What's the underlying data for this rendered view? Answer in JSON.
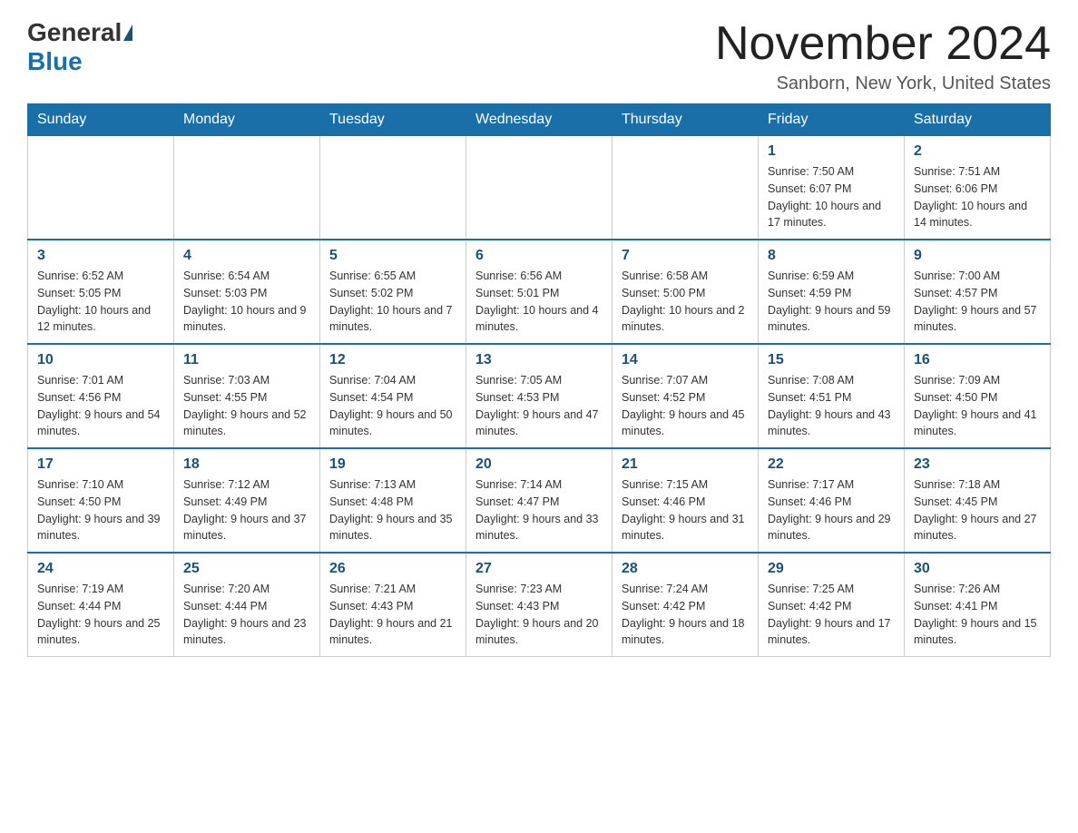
{
  "header": {
    "logo_general": "General",
    "logo_blue": "Blue",
    "month_title": "November 2024",
    "location": "Sanborn, New York, United States"
  },
  "weekdays": [
    "Sunday",
    "Monday",
    "Tuesday",
    "Wednesday",
    "Thursday",
    "Friday",
    "Saturday"
  ],
  "weeks": [
    [
      {
        "day": "",
        "sunrise": "",
        "sunset": "",
        "daylight": ""
      },
      {
        "day": "",
        "sunrise": "",
        "sunset": "",
        "daylight": ""
      },
      {
        "day": "",
        "sunrise": "",
        "sunset": "",
        "daylight": ""
      },
      {
        "day": "",
        "sunrise": "",
        "sunset": "",
        "daylight": ""
      },
      {
        "day": "",
        "sunrise": "",
        "sunset": "",
        "daylight": ""
      },
      {
        "day": "1",
        "sunrise": "Sunrise: 7:50 AM",
        "sunset": "Sunset: 6:07 PM",
        "daylight": "Daylight: 10 hours and 17 minutes."
      },
      {
        "day": "2",
        "sunrise": "Sunrise: 7:51 AM",
        "sunset": "Sunset: 6:06 PM",
        "daylight": "Daylight: 10 hours and 14 minutes."
      }
    ],
    [
      {
        "day": "3",
        "sunrise": "Sunrise: 6:52 AM",
        "sunset": "Sunset: 5:05 PM",
        "daylight": "Daylight: 10 hours and 12 minutes."
      },
      {
        "day": "4",
        "sunrise": "Sunrise: 6:54 AM",
        "sunset": "Sunset: 5:03 PM",
        "daylight": "Daylight: 10 hours and 9 minutes."
      },
      {
        "day": "5",
        "sunrise": "Sunrise: 6:55 AM",
        "sunset": "Sunset: 5:02 PM",
        "daylight": "Daylight: 10 hours and 7 minutes."
      },
      {
        "day": "6",
        "sunrise": "Sunrise: 6:56 AM",
        "sunset": "Sunset: 5:01 PM",
        "daylight": "Daylight: 10 hours and 4 minutes."
      },
      {
        "day": "7",
        "sunrise": "Sunrise: 6:58 AM",
        "sunset": "Sunset: 5:00 PM",
        "daylight": "Daylight: 10 hours and 2 minutes."
      },
      {
        "day": "8",
        "sunrise": "Sunrise: 6:59 AM",
        "sunset": "Sunset: 4:59 PM",
        "daylight": "Daylight: 9 hours and 59 minutes."
      },
      {
        "day": "9",
        "sunrise": "Sunrise: 7:00 AM",
        "sunset": "Sunset: 4:57 PM",
        "daylight": "Daylight: 9 hours and 57 minutes."
      }
    ],
    [
      {
        "day": "10",
        "sunrise": "Sunrise: 7:01 AM",
        "sunset": "Sunset: 4:56 PM",
        "daylight": "Daylight: 9 hours and 54 minutes."
      },
      {
        "day": "11",
        "sunrise": "Sunrise: 7:03 AM",
        "sunset": "Sunset: 4:55 PM",
        "daylight": "Daylight: 9 hours and 52 minutes."
      },
      {
        "day": "12",
        "sunrise": "Sunrise: 7:04 AM",
        "sunset": "Sunset: 4:54 PM",
        "daylight": "Daylight: 9 hours and 50 minutes."
      },
      {
        "day": "13",
        "sunrise": "Sunrise: 7:05 AM",
        "sunset": "Sunset: 4:53 PM",
        "daylight": "Daylight: 9 hours and 47 minutes."
      },
      {
        "day": "14",
        "sunrise": "Sunrise: 7:07 AM",
        "sunset": "Sunset: 4:52 PM",
        "daylight": "Daylight: 9 hours and 45 minutes."
      },
      {
        "day": "15",
        "sunrise": "Sunrise: 7:08 AM",
        "sunset": "Sunset: 4:51 PM",
        "daylight": "Daylight: 9 hours and 43 minutes."
      },
      {
        "day": "16",
        "sunrise": "Sunrise: 7:09 AM",
        "sunset": "Sunset: 4:50 PM",
        "daylight": "Daylight: 9 hours and 41 minutes."
      }
    ],
    [
      {
        "day": "17",
        "sunrise": "Sunrise: 7:10 AM",
        "sunset": "Sunset: 4:50 PM",
        "daylight": "Daylight: 9 hours and 39 minutes."
      },
      {
        "day": "18",
        "sunrise": "Sunrise: 7:12 AM",
        "sunset": "Sunset: 4:49 PM",
        "daylight": "Daylight: 9 hours and 37 minutes."
      },
      {
        "day": "19",
        "sunrise": "Sunrise: 7:13 AM",
        "sunset": "Sunset: 4:48 PM",
        "daylight": "Daylight: 9 hours and 35 minutes."
      },
      {
        "day": "20",
        "sunrise": "Sunrise: 7:14 AM",
        "sunset": "Sunset: 4:47 PM",
        "daylight": "Daylight: 9 hours and 33 minutes."
      },
      {
        "day": "21",
        "sunrise": "Sunrise: 7:15 AM",
        "sunset": "Sunset: 4:46 PM",
        "daylight": "Daylight: 9 hours and 31 minutes."
      },
      {
        "day": "22",
        "sunrise": "Sunrise: 7:17 AM",
        "sunset": "Sunset: 4:46 PM",
        "daylight": "Daylight: 9 hours and 29 minutes."
      },
      {
        "day": "23",
        "sunrise": "Sunrise: 7:18 AM",
        "sunset": "Sunset: 4:45 PM",
        "daylight": "Daylight: 9 hours and 27 minutes."
      }
    ],
    [
      {
        "day": "24",
        "sunrise": "Sunrise: 7:19 AM",
        "sunset": "Sunset: 4:44 PM",
        "daylight": "Daylight: 9 hours and 25 minutes."
      },
      {
        "day": "25",
        "sunrise": "Sunrise: 7:20 AM",
        "sunset": "Sunset: 4:44 PM",
        "daylight": "Daylight: 9 hours and 23 minutes."
      },
      {
        "day": "26",
        "sunrise": "Sunrise: 7:21 AM",
        "sunset": "Sunset: 4:43 PM",
        "daylight": "Daylight: 9 hours and 21 minutes."
      },
      {
        "day": "27",
        "sunrise": "Sunrise: 7:23 AM",
        "sunset": "Sunset: 4:43 PM",
        "daylight": "Daylight: 9 hours and 20 minutes."
      },
      {
        "day": "28",
        "sunrise": "Sunrise: 7:24 AM",
        "sunset": "Sunset: 4:42 PM",
        "daylight": "Daylight: 9 hours and 18 minutes."
      },
      {
        "day": "29",
        "sunrise": "Sunrise: 7:25 AM",
        "sunset": "Sunset: 4:42 PM",
        "daylight": "Daylight: 9 hours and 17 minutes."
      },
      {
        "day": "30",
        "sunrise": "Sunrise: 7:26 AM",
        "sunset": "Sunset: 4:41 PM",
        "daylight": "Daylight: 9 hours and 15 minutes."
      }
    ]
  ]
}
